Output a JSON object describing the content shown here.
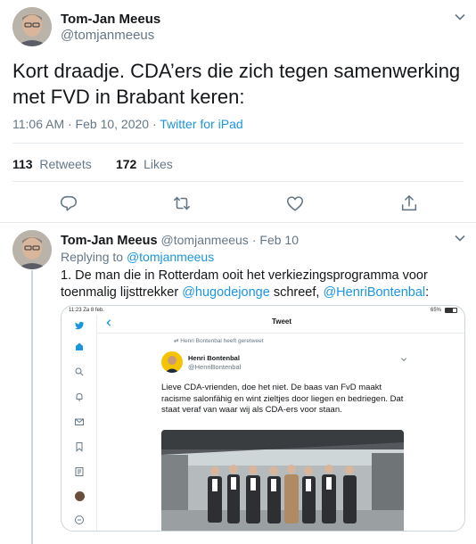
{
  "main_tweet": {
    "author_name": "Tom-Jan Meeus",
    "author_handle": "@tomjanmeeus",
    "text": "Kort draadje. CDA’ers die zich tegen samenwerking met FVD in Brabant keren:",
    "timestamp": "11:06 AM · Feb 10, 2020",
    "separator": " · ",
    "source": "Twitter for iPad",
    "retweets_count": "113",
    "retweets_label": "Retweets",
    "likes_count": "172",
    "likes_label": "Likes"
  },
  "reply_tweet": {
    "author_name": "Tom-Jan Meeus",
    "author_handle": "@tomjanmeeus",
    "date": "· Feb 10",
    "replying_label": "Replying to",
    "replying_to": "@tomjanmeeus",
    "text_part1": "1. De man die in Rotterdam ooit het verkiezingsprogramma voor toenmalig lijsttrekker",
    "mention1": "@hugodejonge",
    "text_part2": "schreef,",
    "mention2": "@HenriBontenbal",
    "text_part3": ":"
  },
  "embedded_screenshot": {
    "status_left": "11:23  Za 8 feb.",
    "status_right": "65%",
    "header_title": "Tweet",
    "retweet_note": "Henri Bontenbal heeft geretweet",
    "inner_name": "Henri Bontenbal",
    "inner_handle": "@HenriBontenbal",
    "inner_text": "Lieve CDA-vrienden, doe het niet. De baas van FvD maakt racisme salonfähig en wint zieltjes door liegen en bedriegen. Dat staat veraf van waar wij als CDA-ers voor staan."
  },
  "colors": {
    "twitter_blue": "#1b95e0",
    "text_secondary": "#657786",
    "divider": "#e6ecf0"
  },
  "icons": [
    "chevron-down-icon",
    "reply-icon",
    "retweet-icon",
    "like-icon",
    "share-icon"
  ]
}
